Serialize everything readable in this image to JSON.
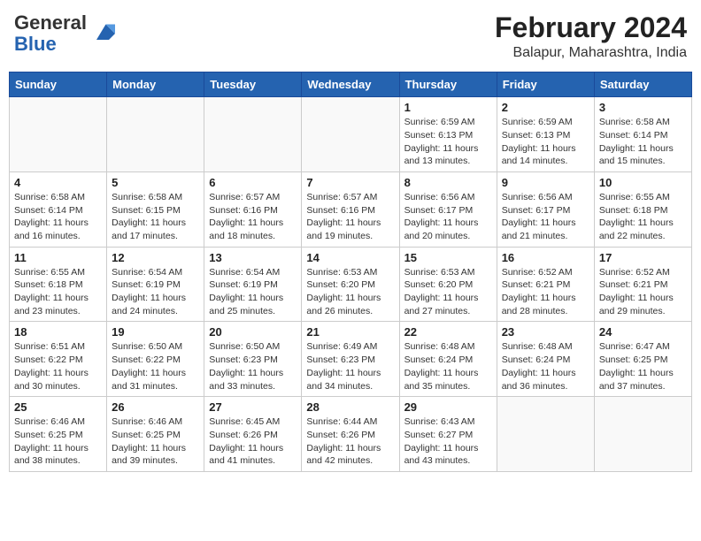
{
  "header": {
    "logo_line1": "General",
    "logo_line2": "Blue",
    "title": "February 2024",
    "subtitle": "Balapur, Maharashtra, India"
  },
  "weekdays": [
    "Sunday",
    "Monday",
    "Tuesday",
    "Wednesday",
    "Thursday",
    "Friday",
    "Saturday"
  ],
  "weeks": [
    [
      {
        "day": "",
        "info": ""
      },
      {
        "day": "",
        "info": ""
      },
      {
        "day": "",
        "info": ""
      },
      {
        "day": "",
        "info": ""
      },
      {
        "day": "1",
        "info": "Sunrise: 6:59 AM\nSunset: 6:13 PM\nDaylight: 11 hours\nand 13 minutes."
      },
      {
        "day": "2",
        "info": "Sunrise: 6:59 AM\nSunset: 6:13 PM\nDaylight: 11 hours\nand 14 minutes."
      },
      {
        "day": "3",
        "info": "Sunrise: 6:58 AM\nSunset: 6:14 PM\nDaylight: 11 hours\nand 15 minutes."
      }
    ],
    [
      {
        "day": "4",
        "info": "Sunrise: 6:58 AM\nSunset: 6:14 PM\nDaylight: 11 hours\nand 16 minutes."
      },
      {
        "day": "5",
        "info": "Sunrise: 6:58 AM\nSunset: 6:15 PM\nDaylight: 11 hours\nand 17 minutes."
      },
      {
        "day": "6",
        "info": "Sunrise: 6:57 AM\nSunset: 6:16 PM\nDaylight: 11 hours\nand 18 minutes."
      },
      {
        "day": "7",
        "info": "Sunrise: 6:57 AM\nSunset: 6:16 PM\nDaylight: 11 hours\nand 19 minutes."
      },
      {
        "day": "8",
        "info": "Sunrise: 6:56 AM\nSunset: 6:17 PM\nDaylight: 11 hours\nand 20 minutes."
      },
      {
        "day": "9",
        "info": "Sunrise: 6:56 AM\nSunset: 6:17 PM\nDaylight: 11 hours\nand 21 minutes."
      },
      {
        "day": "10",
        "info": "Sunrise: 6:55 AM\nSunset: 6:18 PM\nDaylight: 11 hours\nand 22 minutes."
      }
    ],
    [
      {
        "day": "11",
        "info": "Sunrise: 6:55 AM\nSunset: 6:18 PM\nDaylight: 11 hours\nand 23 minutes."
      },
      {
        "day": "12",
        "info": "Sunrise: 6:54 AM\nSunset: 6:19 PM\nDaylight: 11 hours\nand 24 minutes."
      },
      {
        "day": "13",
        "info": "Sunrise: 6:54 AM\nSunset: 6:19 PM\nDaylight: 11 hours\nand 25 minutes."
      },
      {
        "day": "14",
        "info": "Sunrise: 6:53 AM\nSunset: 6:20 PM\nDaylight: 11 hours\nand 26 minutes."
      },
      {
        "day": "15",
        "info": "Sunrise: 6:53 AM\nSunset: 6:20 PM\nDaylight: 11 hours\nand 27 minutes."
      },
      {
        "day": "16",
        "info": "Sunrise: 6:52 AM\nSunset: 6:21 PM\nDaylight: 11 hours\nand 28 minutes."
      },
      {
        "day": "17",
        "info": "Sunrise: 6:52 AM\nSunset: 6:21 PM\nDaylight: 11 hours\nand 29 minutes."
      }
    ],
    [
      {
        "day": "18",
        "info": "Sunrise: 6:51 AM\nSunset: 6:22 PM\nDaylight: 11 hours\nand 30 minutes."
      },
      {
        "day": "19",
        "info": "Sunrise: 6:50 AM\nSunset: 6:22 PM\nDaylight: 11 hours\nand 31 minutes."
      },
      {
        "day": "20",
        "info": "Sunrise: 6:50 AM\nSunset: 6:23 PM\nDaylight: 11 hours\nand 33 minutes."
      },
      {
        "day": "21",
        "info": "Sunrise: 6:49 AM\nSunset: 6:23 PM\nDaylight: 11 hours\nand 34 minutes."
      },
      {
        "day": "22",
        "info": "Sunrise: 6:48 AM\nSunset: 6:24 PM\nDaylight: 11 hours\nand 35 minutes."
      },
      {
        "day": "23",
        "info": "Sunrise: 6:48 AM\nSunset: 6:24 PM\nDaylight: 11 hours\nand 36 minutes."
      },
      {
        "day": "24",
        "info": "Sunrise: 6:47 AM\nSunset: 6:25 PM\nDaylight: 11 hours\nand 37 minutes."
      }
    ],
    [
      {
        "day": "25",
        "info": "Sunrise: 6:46 AM\nSunset: 6:25 PM\nDaylight: 11 hours\nand 38 minutes."
      },
      {
        "day": "26",
        "info": "Sunrise: 6:46 AM\nSunset: 6:25 PM\nDaylight: 11 hours\nand 39 minutes."
      },
      {
        "day": "27",
        "info": "Sunrise: 6:45 AM\nSunset: 6:26 PM\nDaylight: 11 hours\nand 41 minutes."
      },
      {
        "day": "28",
        "info": "Sunrise: 6:44 AM\nSunset: 6:26 PM\nDaylight: 11 hours\nand 42 minutes."
      },
      {
        "day": "29",
        "info": "Sunrise: 6:43 AM\nSunset: 6:27 PM\nDaylight: 11 hours\nand 43 minutes."
      },
      {
        "day": "",
        "info": ""
      },
      {
        "day": "",
        "info": ""
      }
    ]
  ]
}
